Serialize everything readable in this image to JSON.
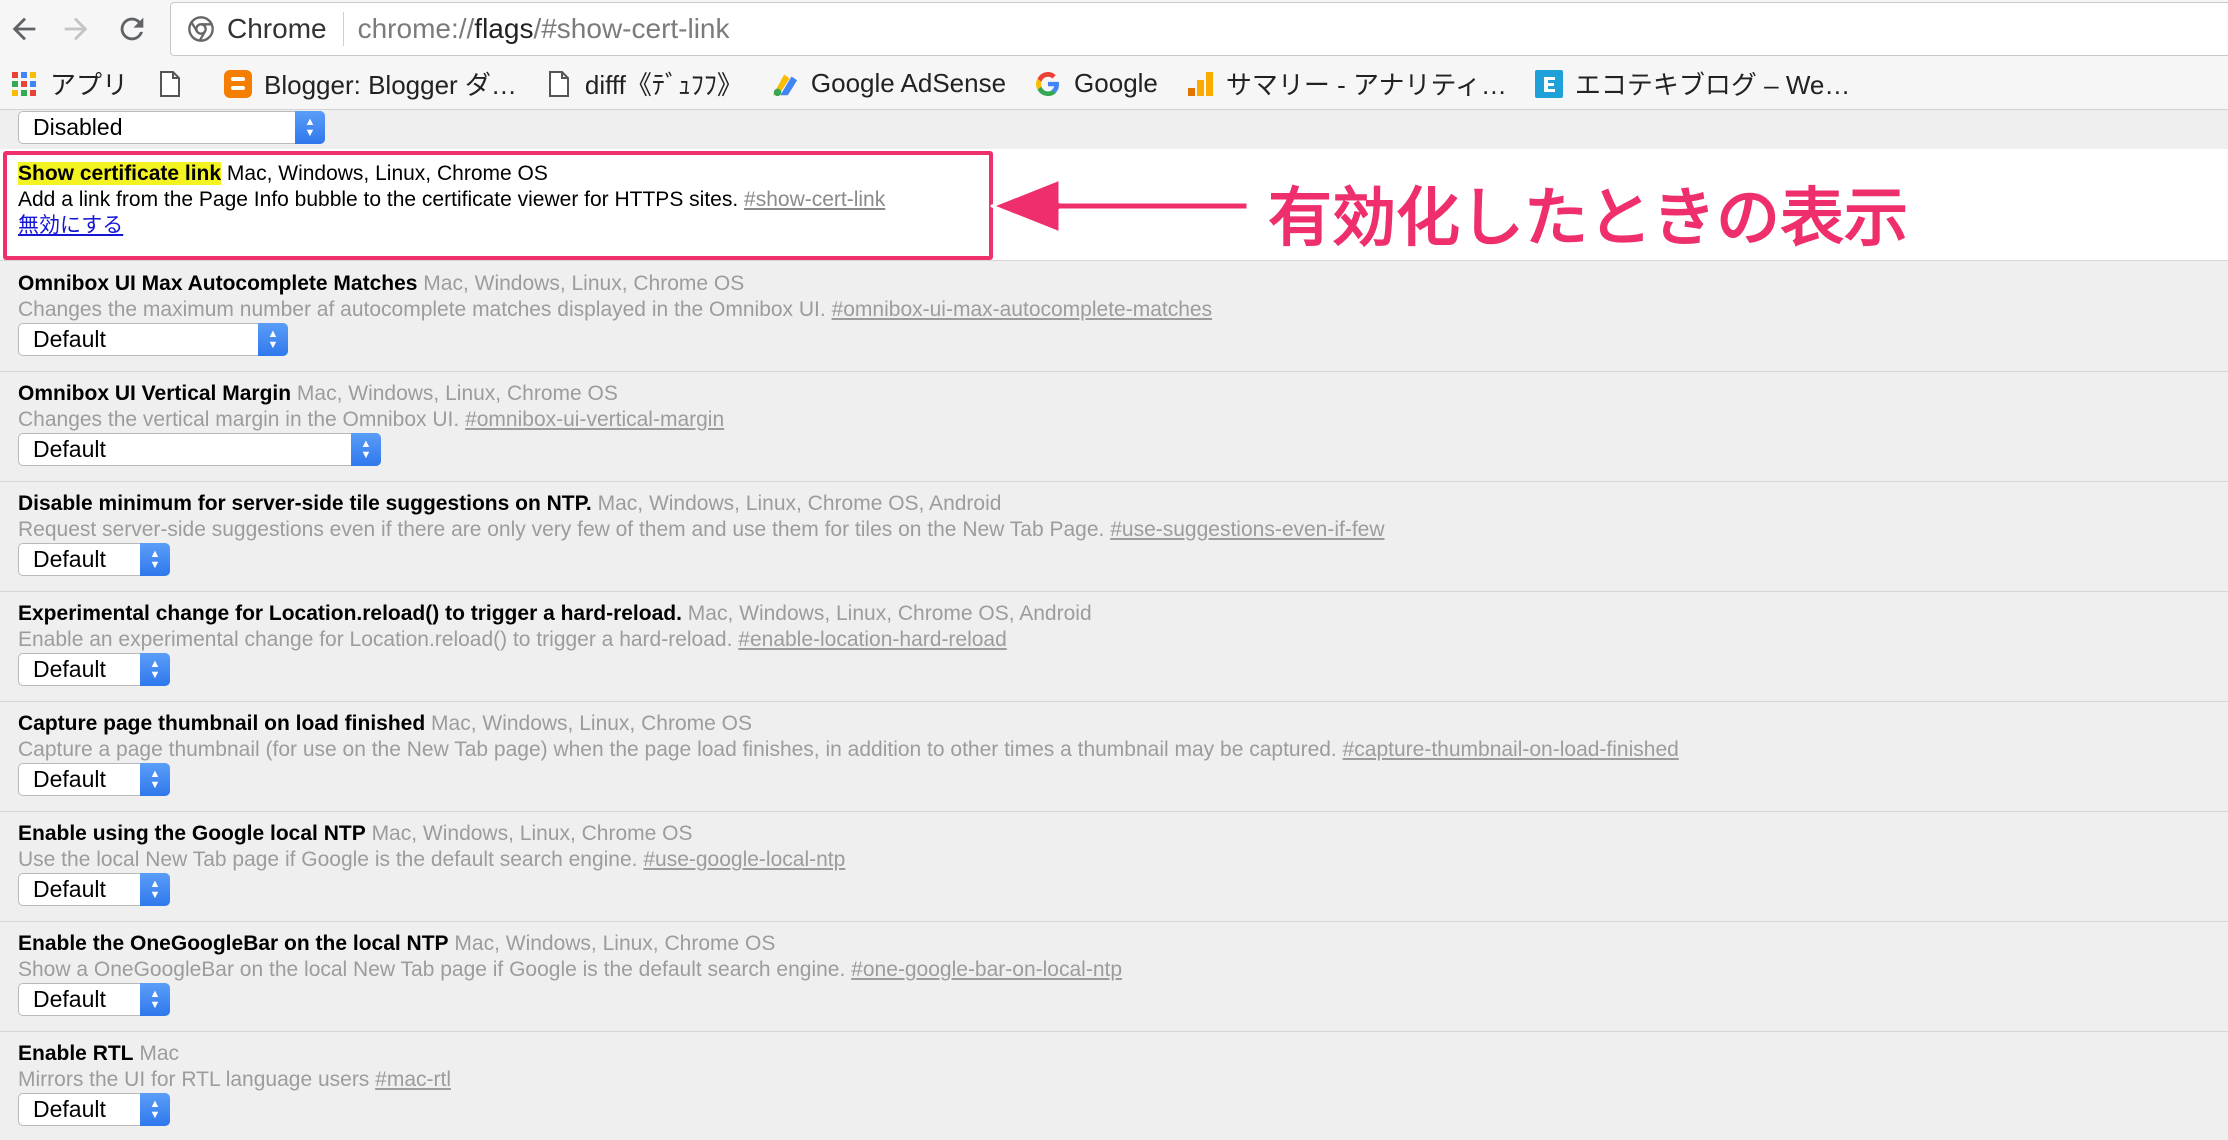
{
  "browser": {
    "omnibox_chip": "Chrome",
    "url_scheme": "chrome://",
    "url_host": "flags",
    "url_path": "/#show-cert-link"
  },
  "bookmarks": [
    {
      "icon": "apps-grid-icon",
      "label": "アプリ"
    },
    {
      "icon": "page-icon",
      "label": ""
    },
    {
      "icon": "blogger-icon",
      "label": "Blogger: Blogger ダ…"
    },
    {
      "icon": "page-icon",
      "label": "difff《ﾃﾞｭﾌﾌ》"
    },
    {
      "icon": "adsense-icon",
      "label": "Google AdSense"
    },
    {
      "icon": "google-icon",
      "label": "Google"
    },
    {
      "icon": "analytics-icon",
      "label": "サマリー - アナリティ…"
    },
    {
      "icon": "ecotech-icon",
      "label": "エコテキブログ – We…"
    }
  ],
  "top_select": "Disabled",
  "enabled_flag": {
    "title": "Show certificate link",
    "platforms": "Mac, Windows, Linux, Chrome OS",
    "description": "Add a link from the Page Info bubble to the certificate viewer for HTTPS sites.",
    "anchor": "#show-cert-link",
    "action": "無効にする"
  },
  "annotation": "有効化したときの表示",
  "flags": [
    {
      "title": "Omnibox UI Max Autocomplete Matches",
      "platforms": "Mac, Windows, Linux, Chrome OS",
      "description": "Changes the maximum number af autocomplete matches displayed in the Omnibox UI.",
      "anchor": "#omnibox-ui-max-autocomplete-matches",
      "select": "Default"
    },
    {
      "title": "Omnibox UI Vertical Margin",
      "platforms": "Mac, Windows, Linux, Chrome OS",
      "description": "Changes the vertical margin in the Omnibox UI.",
      "anchor": "#omnibox-ui-vertical-margin",
      "select": "Default"
    },
    {
      "title": "Disable minimum for server-side tile suggestions on NTP.",
      "platforms": "Mac, Windows, Linux, Chrome OS, Android",
      "description": "Request server-side suggestions even if there are only very few of them and use them for tiles on the New Tab Page.",
      "anchor": "#use-suggestions-even-if-few",
      "select": "Default"
    },
    {
      "title": "Experimental change for Location.reload() to trigger a hard-reload.",
      "platforms": "Mac, Windows, Linux, Chrome OS, Android",
      "description": "Enable an experimental change for Location.reload() to trigger a hard-reload.",
      "anchor": "#enable-location-hard-reload",
      "select": "Default"
    },
    {
      "title": "Capture page thumbnail on load finished",
      "platforms": "Mac, Windows, Linux, Chrome OS",
      "description": "Capture a page thumbnail (for use on the New Tab page) when the page load finishes, in addition to other times a thumbnail may be captured.",
      "anchor": "#capture-thumbnail-on-load-finished",
      "select": "Default"
    },
    {
      "title": "Enable using the Google local NTP",
      "platforms": "Mac, Windows, Linux, Chrome OS",
      "description": "Use the local New Tab page if Google is the default search engine.",
      "anchor": "#use-google-local-ntp",
      "select": "Default"
    },
    {
      "title": "Enable the OneGoogleBar on the local NTP",
      "platforms": "Mac, Windows, Linux, Chrome OS",
      "description": "Show a OneGoogleBar on the local New Tab page if Google is the default search engine.",
      "anchor": "#one-google-bar-on-local-ntp",
      "select": "Default"
    },
    {
      "title": "Enable RTL",
      "platforms": "Mac",
      "description": "Mirrors the UI for RTL language users",
      "anchor": "#mac-rtl",
      "select": "Default"
    }
  ],
  "colors": {
    "annotation": "#ee2f6c",
    "highlight": "#f4f322",
    "select_arrow": "#2f78ec"
  }
}
